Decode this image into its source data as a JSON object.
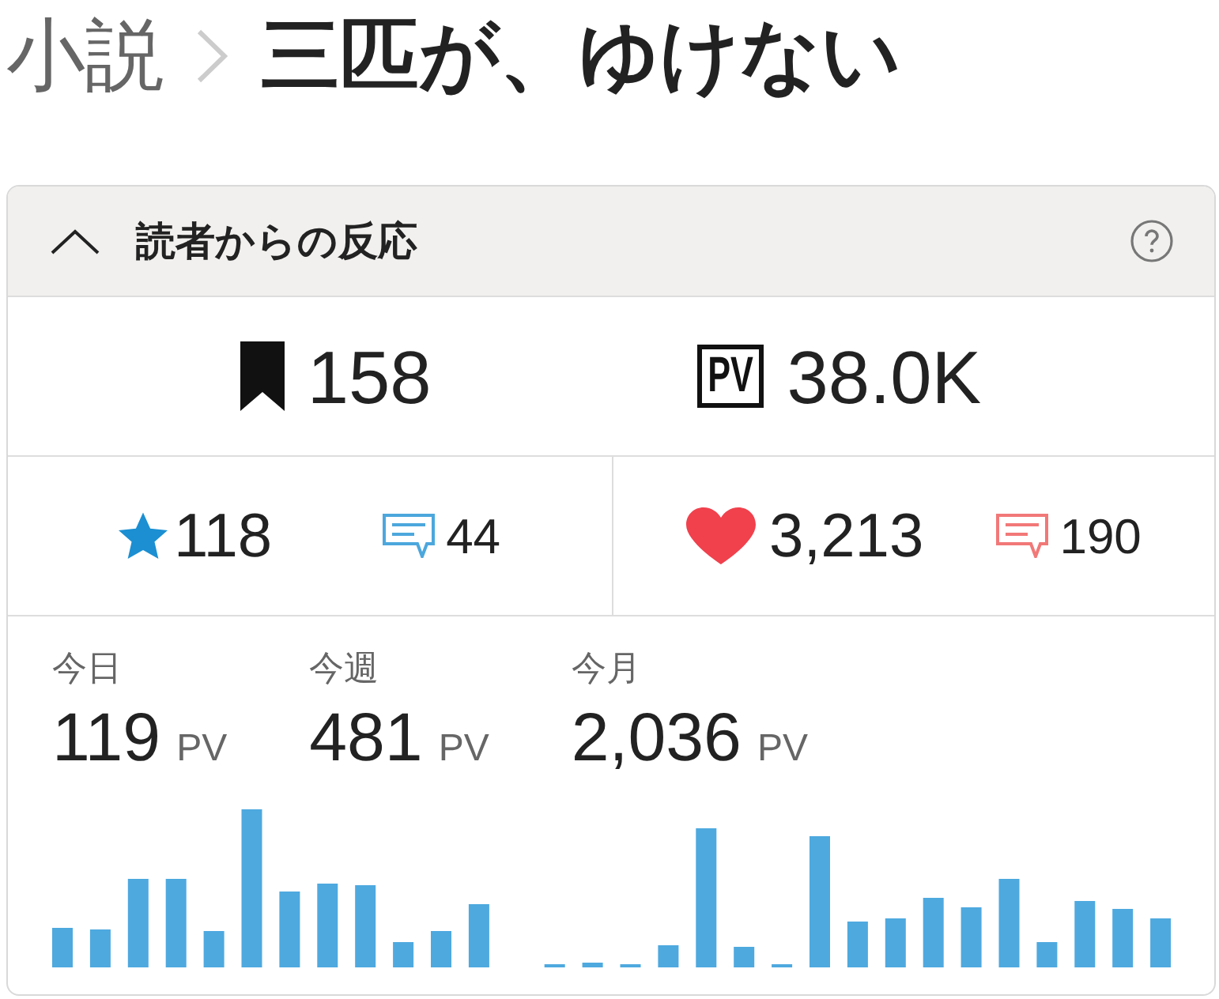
{
  "breadcrumb": {
    "parent": "小説",
    "title": "三匹が、ゆけない"
  },
  "panel": {
    "title": "読者からの反応",
    "expanded": true
  },
  "totals": [
    {
      "kind": "bookmarks",
      "value": "158"
    },
    {
      "kind": "page_views",
      "badge": "PV",
      "value": "38.0K"
    }
  ],
  "reactions": [
    {
      "kind": "stars",
      "value": "118",
      "comments": "44"
    },
    {
      "kind": "hearts",
      "value": "3,213",
      "comments": "190"
    }
  ],
  "page_views": [
    {
      "label": "今日",
      "value": "119",
      "unit": "PV"
    },
    {
      "label": "今週",
      "value": "481",
      "unit": "PV"
    },
    {
      "label": "今月",
      "value": "2,036",
      "unit": "PV"
    }
  ]
}
